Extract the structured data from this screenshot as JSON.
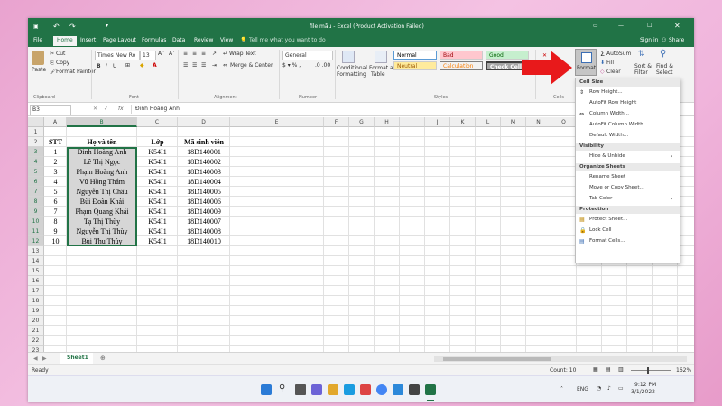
{
  "window": {
    "title": "file mẫu - Excel (Product Activation Failed)",
    "signin": "Sign in",
    "share": "Share"
  },
  "tabs": [
    "File",
    "Home",
    "Insert",
    "Page Layout",
    "Formulas",
    "Data",
    "Review",
    "View"
  ],
  "tell_me": "Tell me what you want to do",
  "ribbon": {
    "paste": "Paste",
    "cut": "Cut",
    "copy": "Copy",
    "format_painter": "Format Painter",
    "clipboard": "Clipboard",
    "font_name": "Times New Ro",
    "font_size": "13",
    "font_group": "Font",
    "wrap_text": "Wrap Text",
    "merge_center": "Merge & Center",
    "alignment": "Alignment",
    "number_format": "General",
    "number": "Number",
    "conditional_formatting_1": "Conditional",
    "conditional_formatting_2": "Formatting",
    "format_as_table_1": "Format as",
    "format_as_table_2": "Table",
    "styles": [
      "Normal",
      "Bad",
      "Good",
      "Neutral",
      "Calculation",
      "Check Cell"
    ],
    "styles_group": "Styles",
    "cells_group": "Cells",
    "format": "Format",
    "autosum": "AutoSum",
    "fill": "Fill",
    "clear": "Clear",
    "sort_filter_1": "Sort &",
    "sort_filter_2": "Filter",
    "find_select_1": "Find &",
    "find_select_2": "Select"
  },
  "name_box": "B3",
  "formula_value": "Đinh Hoàng Anh",
  "columns": [
    "A",
    "B",
    "C",
    "D",
    "E",
    "F",
    "G",
    "H",
    "I",
    "J",
    "K",
    "L",
    "M",
    "N",
    "O",
    "P",
    "Q",
    "R",
    "S"
  ],
  "headers": {
    "stt": "STT",
    "name": "Họ và tên",
    "class": "Lớp",
    "id": "Mã sinh viên"
  },
  "rows": [
    {
      "stt": "1",
      "name": "Đinh Hoàng Anh",
      "class": "K54I1",
      "id": "18D140001"
    },
    {
      "stt": "2",
      "name": "Lê Thị Ngọc",
      "class": "K54I1",
      "id": "18D140002"
    },
    {
      "stt": "3",
      "name": "Phạm Hoàng Anh",
      "class": "K54I1",
      "id": "18D140003"
    },
    {
      "stt": "4",
      "name": "Vũ Hồng Thắm",
      "class": "K54I1",
      "id": "18D140004"
    },
    {
      "stt": "5",
      "name": "Nguyễn Thị Châu",
      "class": "K54I1",
      "id": "18D140005"
    },
    {
      "stt": "6",
      "name": "Bùi Đoàn Khải",
      "class": "K54I1",
      "id": "18D140006"
    },
    {
      "stt": "7",
      "name": "Phạm Quang Khải",
      "class": "K54I1",
      "id": "18D140009"
    },
    {
      "stt": "8",
      "name": "Tạ Thị Thùy",
      "class": "K54I1",
      "id": "18D140007"
    },
    {
      "stt": "9",
      "name": "Nguyễn Thị Thùy",
      "class": "K54I1",
      "id": "18D140008"
    },
    {
      "stt": "10",
      "name": "Bùi Thu Thủy",
      "class": "K54I1",
      "id": "18D140010"
    }
  ],
  "row_numbers": [
    "1",
    "2",
    "3",
    "4",
    "5",
    "6",
    "7",
    "8",
    "9",
    "10",
    "11",
    "12",
    "13",
    "14",
    "15",
    "16",
    "17",
    "18",
    "19",
    "20",
    "21",
    "22",
    "23",
    "24"
  ],
  "format_menu": {
    "cell_size": "Cell Size",
    "row_height": "Row Height...",
    "autofit_row": "AutoFit Row Height",
    "column_width": "Column Width...",
    "autofit_column": "AutoFit Column Width",
    "default_width": "Default Width...",
    "visibility": "Visibility",
    "hide_unhide": "Hide & Unhide",
    "organize": "Organize Sheets",
    "rename": "Rename Sheet",
    "move_copy": "Move or Copy Sheet...",
    "tab_color": "Tab Color",
    "protection": "Protection",
    "protect_sheet": "Protect Sheet...",
    "lock_cell": "Lock Cell",
    "format_cells": "Format Cells..."
  },
  "sheet_tab": "Sheet1",
  "status": {
    "ready": "Ready",
    "count": "Count: 10",
    "zoom": "162%"
  },
  "taskbar": {
    "lang": "ENG",
    "time": "9:12 PM",
    "date": "3/1/2022"
  },
  "colors": {
    "excel_green": "#217346",
    "arrow_red": "#e8191b"
  }
}
